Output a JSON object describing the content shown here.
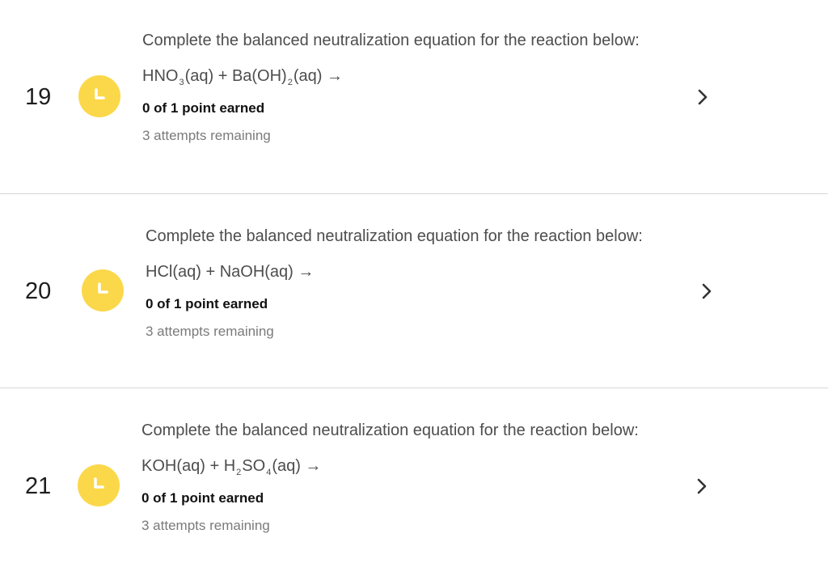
{
  "questions": [
    {
      "number": "19",
      "prompt": "Complete the balanced neutralization equation for the reaction below:",
      "equation": {
        "p1": "HNO",
        "s1": "3",
        "p2": "(aq) + Ba(OH)",
        "s2": "2",
        "p3": "(aq) →"
      },
      "score": "0 of 1 point earned",
      "attempts": "3 attempts remaining",
      "status_icon": "clock-icon"
    },
    {
      "number": "20",
      "prompt": "Complete the balanced neutralization equation for the reaction below:",
      "equation": {
        "p1": "HCl(aq) + NaOH(aq) →"
      },
      "score": "0 of 1 point earned",
      "attempts": "3 attempts remaining",
      "status_icon": "clock-icon"
    },
    {
      "number": "21",
      "prompt": "Complete the balanced neutralization equation for the reaction below:",
      "equation": {
        "p1": "KOH(aq) + H",
        "s1": "2",
        "p2": "SO",
        "s2": "4",
        "p3": "(aq) →"
      },
      "score": "0 of 1 point earned",
      "attempts": "3 attempts remaining",
      "status_icon": "clock-icon"
    }
  ],
  "colors": {
    "status_badge": "#fbd84a",
    "divider": "#d6d6d6",
    "prompt_text": "#4d4d4d",
    "attempts_text": "#7a7a7a"
  }
}
